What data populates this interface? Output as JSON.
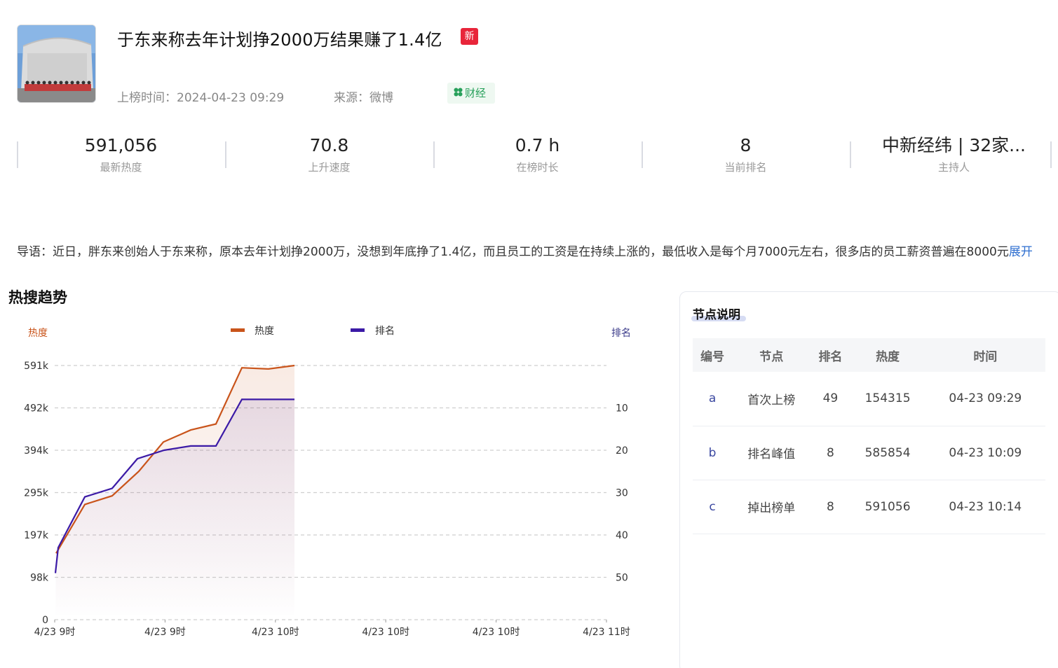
{
  "header": {
    "title": "于东来称去年计划挣2000万结果赚了1.4亿",
    "new_badge": "新",
    "time_label": "上榜时间：2024-04-23 09:29",
    "source_label": "来源：微博",
    "category": "财经"
  },
  "stats": [
    {
      "value": "591,056",
      "label": "最新热度"
    },
    {
      "value": "70.8",
      "label": "上升速度"
    },
    {
      "value": "0.7 h",
      "label": "在榜时长"
    },
    {
      "value": "8",
      "label": "当前排名"
    },
    {
      "value": "中新经纬 | 32家...",
      "label": "主持人"
    }
  ],
  "intro": {
    "text": "导语：近日，胖东来创始人于东来称，原本去年计划挣2000万，没想到年底挣了1.4亿，而且员工的工资是在持续上涨的，最低收入是每个月7000元左右，很多店的员工薪资普遍在8000元",
    "expand_label": "展开"
  },
  "trend_section": {
    "title": "热搜趋势"
  },
  "chart_data": {
    "type": "line",
    "title": "",
    "x_tick_labels": [
      "4/23 9时",
      "4/23 9时",
      "4/23 10时",
      "4/23 10时",
      "4/23 10时",
      "4/23 11时"
    ],
    "left_axis": {
      "label": "热度",
      "ticks": [
        "0",
        "98k",
        "197k",
        "295k",
        "394k",
        "492k",
        "591k"
      ],
      "ylim": [
        0,
        591000
      ]
    },
    "right_axis": {
      "label": "排名",
      "ticks": [
        "10",
        "20",
        "30",
        "40",
        "50"
      ],
      "inverted": true
    },
    "legend": [
      "热度",
      "排名"
    ],
    "legend_position": "top-center",
    "grid": true,
    "colors": {
      "heat": "#c9541b",
      "rank": "#3b1aa6"
    },
    "series": [
      {
        "name": "热度",
        "axis": "left",
        "values": [
          154315,
          268000,
          288000,
          345000,
          413000,
          441000,
          455000,
          585854,
          583000,
          591056
        ]
      },
      {
        "name": "排名",
        "axis": "right",
        "values": [
          49,
          43,
          31,
          29,
          22,
          20,
          19,
          19,
          8,
          8,
          8
        ]
      }
    ]
  },
  "node_panel": {
    "title": "节点说明",
    "columns": [
      "编号",
      "节点",
      "排名",
      "热度",
      "时间"
    ],
    "rows": [
      [
        "a",
        "首次上榜",
        "49",
        "154315",
        "04-23 09:29"
      ],
      [
        "b",
        "排名峰值",
        "8",
        "585854",
        "04-23 10:09"
      ],
      [
        "c",
        "掉出榜单",
        "8",
        "591056",
        "04-23 10:14"
      ]
    ]
  }
}
